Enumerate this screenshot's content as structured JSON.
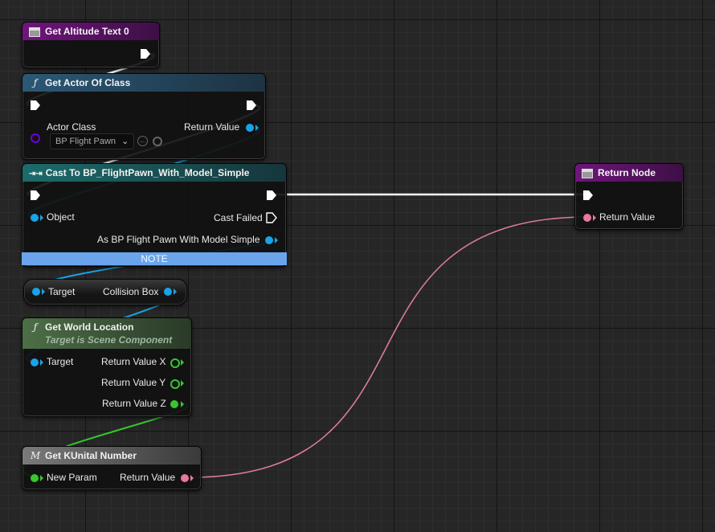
{
  "colors": {
    "exec_wire": "#ffffff",
    "object_pin": "#19a3e7",
    "float_pin": "#37c72d",
    "pink_pin": "#e8789e",
    "class_pin": "#6c00d8",
    "pure_header": "#36552e",
    "func_header": "#2b5876",
    "cast_header": "#1d6b6b",
    "macro_header": "#6c6c6c",
    "event_header": "#70157d",
    "note_bg": "#6aa5ec"
  },
  "nodes": {
    "get_altitude": {
      "title": "Get Altitude Text 0",
      "icon": "function-graph-icon"
    },
    "get_actor": {
      "title": "Get Actor Of Class",
      "icon": "function-icon",
      "actor_class_label": "Actor Class",
      "class_value": "BP Flight Pawn",
      "return_label": "Return Value"
    },
    "cast": {
      "title": "Cast To BP_FlightPawn_With_Model_Simple",
      "object_label": "Object",
      "cast_failed_label": "Cast Failed",
      "as_label": "As BP Flight Pawn With Model Simple",
      "note_label": "NOTE"
    },
    "collision": {
      "target_label": "Target",
      "output_label": "Collision Box"
    },
    "world_loc": {
      "title": "Get World Location",
      "subtitle": "Target is Scene Component",
      "target_label": "Target",
      "x_label": "Return Value X",
      "y_label": "Return Value Y",
      "z_label": "Return Value Z"
    },
    "kunital": {
      "title": "Get KUnital Number",
      "icon_glyph": "M",
      "param_label": "New Param",
      "return_label": "Return Value"
    },
    "return_node": {
      "title": "Return Node",
      "return_label": "Return Value"
    }
  }
}
